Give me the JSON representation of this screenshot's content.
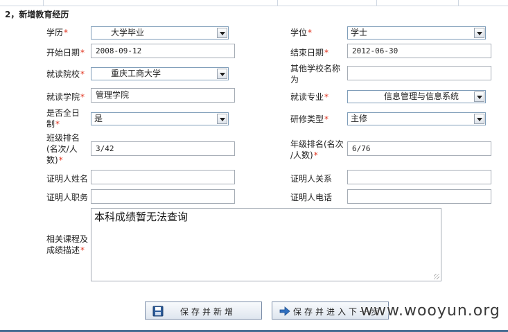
{
  "section": {
    "title": "2，新增教育经历"
  },
  "fields": {
    "degree_type": {
      "label": "学历",
      "value": "大学毕业"
    },
    "degree": {
      "label": "学位",
      "value": "学士"
    },
    "start_date": {
      "label": "开始日期",
      "value": "2008-09-12"
    },
    "end_date": {
      "label": "结束日期",
      "value": "2012-06-30"
    },
    "school": {
      "label": "就读院校",
      "value": "重庆工商大学"
    },
    "other_school": {
      "label": "其他学校名称为",
      "value": ""
    },
    "college": {
      "label": "就读学院",
      "value": "管理学院"
    },
    "major": {
      "label": "就读专业",
      "value": "信息管理与信息系统"
    },
    "full_time": {
      "label_line1": "是否全日",
      "label_line2": "制",
      "value": "是"
    },
    "study_type": {
      "label": "研修类型",
      "value": "主修"
    },
    "class_rank": {
      "label_line1": "班级排名",
      "label_line2": "(名次/人",
      "label_line3": "数)",
      "value": "3/42"
    },
    "grade_rank": {
      "label_line1": "年级排名(名次",
      "label_line2": "/人数)",
      "value": "6/76"
    },
    "ref_name": {
      "label": "证明人姓名",
      "value": ""
    },
    "ref_relation": {
      "label": "证明人关系",
      "value": ""
    },
    "ref_position": {
      "label": "证明人职务",
      "value": ""
    },
    "ref_phone": {
      "label": "证明人电话",
      "value": ""
    },
    "courses": {
      "label_line1": "相关课程及",
      "label_line2": "成绩描述",
      "value": "本科成绩暂无法查询"
    }
  },
  "required_mark": "*",
  "buttons": {
    "save_add": "保存并新增",
    "save_next": "保存并进入下一步"
  },
  "icons": {
    "save": "floppy-disk-icon",
    "next": "arrow-right-icon"
  },
  "watermark": "www.wooyun.org"
}
